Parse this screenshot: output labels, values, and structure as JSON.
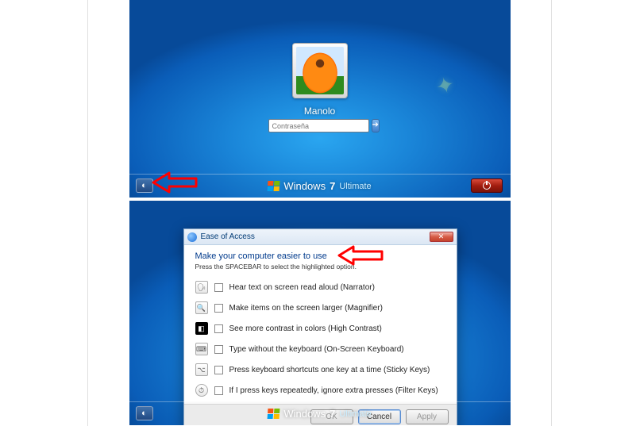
{
  "login": {
    "username": "Manolo",
    "password_placeholder": "Contraseña"
  },
  "branding": {
    "name": "Windows",
    "version": "7",
    "edition": "Ultimate"
  },
  "ease_dialog": {
    "title": "Ease of Access",
    "heading": "Make your computer easier to use",
    "subheading": "Press the SPACEBAR to select the highlighted option.",
    "options": [
      "Hear text on screen read aloud (Narrator)",
      "Make items on the screen larger (Magnifier)",
      "See more contrast in colors (High Contrast)",
      "Type without the keyboard (On-Screen Keyboard)",
      "Press keyboard shortcuts one key at a time (Sticky Keys)",
      "If I press keys repeatedly, ignore extra presses (Filter Keys)"
    ],
    "buttons": {
      "ok": "OK",
      "cancel": "Cancel",
      "apply": "Apply"
    }
  }
}
